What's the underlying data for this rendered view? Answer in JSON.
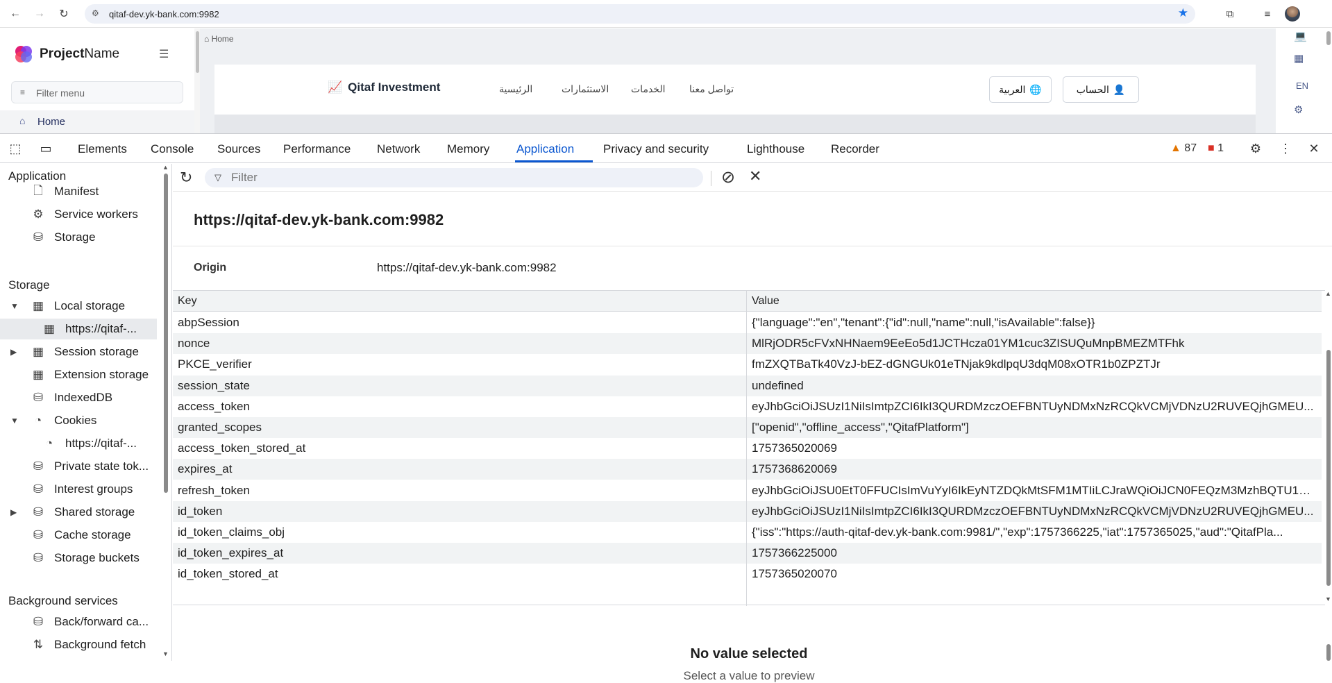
{
  "browser": {
    "url": "qitaf-dev.yk-bank.com:9982"
  },
  "app": {
    "brand_bold": "Project",
    "brand_light": "Name",
    "filter_placeholder": "Filter menu",
    "home_label": "Home",
    "breadcrumb": "Home",
    "qitaf_brand": "Qitaf Investment",
    "nav": [
      "الرئيسية",
      "الاستثمارات",
      "الخدمات",
      "تواصل معنا"
    ],
    "lang_button": "العربية",
    "account_button": "الحساب",
    "right_lang": "EN"
  },
  "devtools": {
    "tabs": [
      "Elements",
      "Console",
      "Sources",
      "Performance",
      "Network",
      "Memory",
      "Application",
      "Privacy and security",
      "Lighthouse",
      "Recorder"
    ],
    "active_tab": "Application",
    "warnings_count": "87",
    "errors_count": "1",
    "sidebar": {
      "application_header": "Application",
      "application_items": [
        "Manifest",
        "Service workers",
        "Storage"
      ],
      "storage_header": "Storage",
      "local_storage": "Local storage",
      "local_storage_child": "https://qitaf-...",
      "session_storage": "Session storage",
      "extension_storage": "Extension storage",
      "indexeddb": "IndexedDB",
      "cookies": "Cookies",
      "cookies_child": "https://qitaf-...",
      "private_state": "Private state tok...",
      "interest_groups": "Interest groups",
      "shared_storage": "Shared storage",
      "cache_storage": "Cache storage",
      "storage_buckets": "Storage buckets",
      "background_header": "Background services",
      "back_forward": "Back/forward ca...",
      "background_fetch": "Background fetch"
    },
    "filter_placeholder": "Filter",
    "origin_title": "https://qitaf-dev.yk-bank.com:9982",
    "origin_label": "Origin",
    "origin_value": "https://qitaf-dev.yk-bank.com:9982",
    "columns": {
      "key": "Key",
      "value": "Value"
    },
    "rows": [
      {
        "k": "abpSession",
        "v": "{\"language\":\"en\",\"tenant\":{\"id\":null,\"name\":null,\"isAvailable\":false}}"
      },
      {
        "k": "nonce",
        "v": "MlRjODR5cFVxNHNaem9EeEo5d1JCTHcza01YM1cuc3ZISUQuMnpBMEZMTFhk"
      },
      {
        "k": "PKCE_verifier",
        "v": "fmZXQTBaTk40VzJ-bEZ-dGNGUk01eTNjak9kdlpqU3dqM08xOTR1b0ZPZTJr"
      },
      {
        "k": "session_state",
        "v": "undefined"
      },
      {
        "k": "access_token",
        "v": "eyJhbGciOiJSUzI1NiIsImtpZCI6IkI3QURDMzczOEFBNTUyNDMxNzRCQkVCMjVDNzU2RUVEQjhGMEU..."
      },
      {
        "k": "granted_scopes",
        "v": "[\"openid\",\"offline_access\",\"QitafPlatform\"]"
      },
      {
        "k": "access_token_stored_at",
        "v": "1757365020069"
      },
      {
        "k": "expires_at",
        "v": "1757368620069"
      },
      {
        "k": "refresh_token",
        "v": "eyJhbGciOiJSU0EtT0FFUCIsImVuYyI6IkEyNTZDQkMtSFM1MTIiLCJraWQiOiJCN0FEQzM3MzhBQTU1M..."
      },
      {
        "k": "id_token",
        "v": "eyJhbGciOiJSUzI1NiIsImtpZCI6IkI3QURDMzczOEFBNTUyNDMxNzRCQkVCMjVDNzU2RUVEQjhGMEU..."
      },
      {
        "k": "id_token_claims_obj",
        "v": "{\"iss\":\"https://auth-qitaf-dev.yk-bank.com:9981/\",\"exp\":1757366225,\"iat\":1757365025,\"aud\":\"QitafPla..."
      },
      {
        "k": "id_token_expires_at",
        "v": "1757366225000"
      },
      {
        "k": "id_token_stored_at",
        "v": "1757365020070"
      }
    ],
    "preview_title": "No value selected",
    "preview_sub": "Select a value to preview"
  }
}
